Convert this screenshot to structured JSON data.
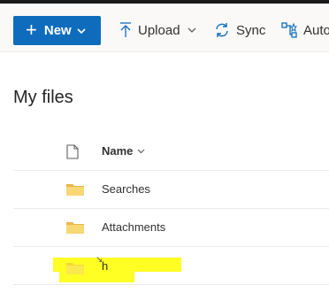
{
  "toolbar": {
    "new_label": "New",
    "upload_label": "Upload",
    "sync_label": "Sync",
    "automate_label": "Auto"
  },
  "page": {
    "title": "My files"
  },
  "file_list": {
    "column_name_label": "Name",
    "items": [
      {
        "name": "Searches",
        "icon": "folder-icon"
      },
      {
        "name": "Attachments",
        "icon": "folder-icon"
      },
      {
        "name": "h",
        "icon": "folder-icon",
        "highlighted": true
      }
    ]
  },
  "colors": {
    "accent": "#0f6cbd",
    "highlight": "#ffff24",
    "folder": "#f8d775"
  }
}
